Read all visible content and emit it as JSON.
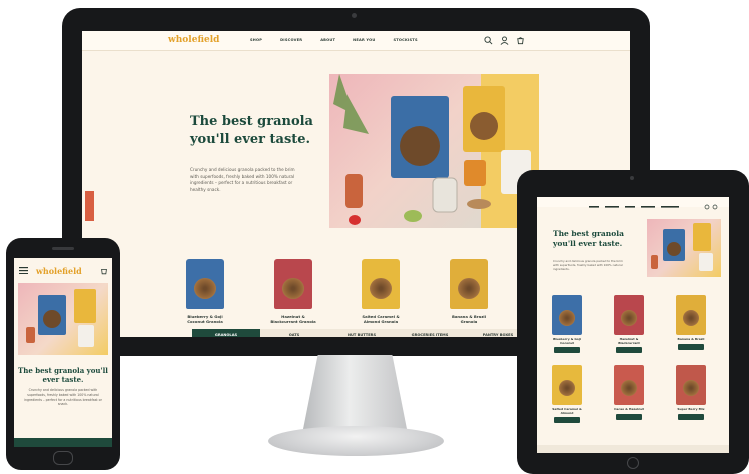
{
  "desktop": {
    "logo": "wholefield",
    "nav_items": [
      "SHOP",
      "DISCOVER",
      "ABOUT",
      "NEAR YOU",
      "STOCKISTS"
    ],
    "hero_title_line1": "The best granola",
    "hero_title_line2": "you'll ever taste.",
    "hero_body": "Crunchy and delicious granola packed to the brim with superfoods, freshly baked with 100% natural ingredients – perfect for a nutritious breakfast or healthy snack.",
    "products": [
      {
        "name": "Blueberry & Goji Coconut Granola",
        "color": "#3d6fa8"
      },
      {
        "name": "Hazelnut & Blackcurrant Granola",
        "color": "#b9474d"
      },
      {
        "name": "Salted Caramel & Almond Granola",
        "color": "#e7b93d"
      },
      {
        "name": "Banana & Brazil Granola",
        "color": "#e0ae3a"
      }
    ],
    "categories": [
      "GRANOLAS",
      "OATS",
      "NUT BUTTERS",
      "GROCERIES ITEMS",
      "PANTRY BOXES"
    ]
  },
  "phone": {
    "logo": "wholefield",
    "hero_title": "The best granola you'll ever taste.",
    "hero_body": "Crunchy and delicious granola packed with superfoods, freshly baked with 100% natural ingredients – perfect for a nutritious breakfast or snack."
  },
  "tablet": {
    "hero_title_line1": "The best granola",
    "hero_title_line2": "you'll ever taste.",
    "hero_body": "Crunchy and delicious granola packed to the brim with superfoods, freshly baked with 100% natural ingredients.",
    "products": [
      {
        "name": "Blueberry & Goji Coconut",
        "color": "#3d6fa8"
      },
      {
        "name": "Hazelnut & Blackcurrant",
        "color": "#b9474d"
      },
      {
        "name": "Banana & Brazil",
        "color": "#e0ae3a"
      },
      {
        "name": "Salted Caramel & Almond",
        "color": "#e7b93d"
      },
      {
        "name": "Cacao & Hazelnut",
        "color": "#c95a4e"
      },
      {
        "name": "Super Berry Mix",
        "color": "#c0584b"
      }
    ]
  },
  "colors": {
    "brand_green": "#1f4a3c",
    "brand_orange": "#e3a12a",
    "background": "#fcf5ea"
  }
}
